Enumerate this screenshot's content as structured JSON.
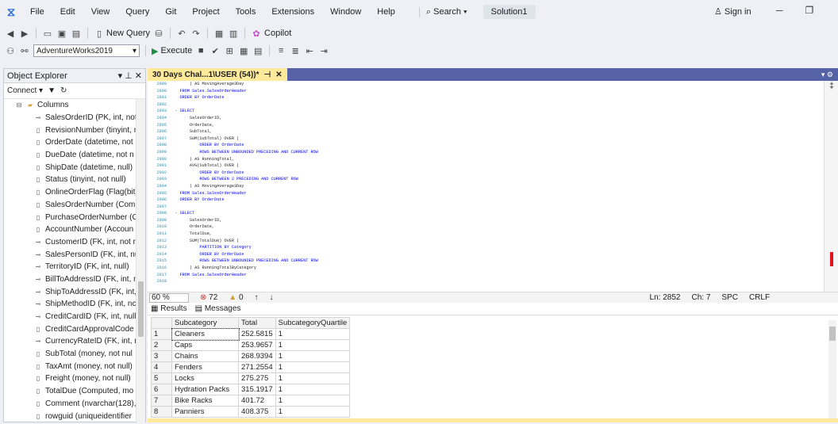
{
  "menu": {
    "items": [
      "File",
      "Edit",
      "View",
      "Query",
      "Git",
      "Project",
      "Tools",
      "Extensions",
      "Window",
      "Help"
    ],
    "search": "Search",
    "solution": "Solution1",
    "signin": "Sign in"
  },
  "toolbar": {
    "new_query": "New Query",
    "copilot": "Copilot",
    "database": "AdventureWorks2019",
    "execute": "Execute"
  },
  "object_explorer": {
    "title": "Object Explorer",
    "connect": "Connect",
    "columns_folder": "Columns",
    "columns": [
      "SalesOrderID (PK, int, not",
      "RevisionNumber (tinyint, n",
      "OrderDate (datetime, not",
      "DueDate (datetime, not n",
      "ShipDate (datetime, null)",
      "Status (tinyint, not null)",
      "OnlineOrderFlag (Flag(bit)",
      "SalesOrderNumber (Comp",
      "PurchaseOrderNumber (C",
      "AccountNumber (Accoun",
      "CustomerID (FK, int, not r",
      "SalesPersonID (FK, int, nul",
      "TerritoryID (FK, int, null)",
      "BillToAddressID (FK, int, n",
      "ShipToAddressID (FK, int,",
      "ShipMethodID (FK, int, nc",
      "CreditCardID (FK, int, null)",
      "CreditCardApprovalCode",
      "CurrencyRateID (FK, int, n",
      "SubTotal (money, not nul",
      "TaxAmt (money, not null)",
      "Freight (money, not null)",
      "TotalDue (Computed, mo",
      "Comment (nvarchar(128),",
      "rowguid (uniqueidentifier"
    ]
  },
  "tab": {
    "title": "30 Days Chal...1\\USER (54))*"
  },
  "editor": {
    "lines": [
      {
        "n": "2889",
        "t": "        ) AS MovingAverage3Day"
      },
      {
        "n": "2890",
        "t": "    FROM Sales.SalesOrderHeader"
      },
      {
        "n": "2891",
        "t": "    ORDER BY OrderDate"
      },
      {
        "n": "2892",
        "t": ""
      },
      {
        "n": "2893",
        "t": "  - SELECT"
      },
      {
        "n": "2894",
        "t": "        SalesOrderID,"
      },
      {
        "n": "2895",
        "t": "        OrderDate,"
      },
      {
        "n": "2896",
        "t": "        SubTotal,"
      },
      {
        "n": "2897",
        "t": "        SUM(SubTotal) OVER ("
      },
      {
        "n": "2898",
        "t": "            ORDER BY OrderDate"
      },
      {
        "n": "2899",
        "t": "            ROWS BETWEEN UNBOUNDED PRECEDING AND CURRENT ROW"
      },
      {
        "n": "2900",
        "t": "        ) AS RunningTotal,"
      },
      {
        "n": "2901",
        "t": "        AVG(SubTotal) OVER ("
      },
      {
        "n": "2902",
        "t": "            ORDER BY OrderDate"
      },
      {
        "n": "2903",
        "t": "            ROWS BETWEEN 2 PRECEDING AND CURRENT ROW"
      },
      {
        "n": "2904",
        "t": "        ) AS MovingAverage3Day"
      },
      {
        "n": "2905",
        "t": "    FROM Sales.SalesOrderHeader"
      },
      {
        "n": "2906",
        "t": "    ORDER BY OrderDate"
      },
      {
        "n": "2907",
        "t": ""
      },
      {
        "n": "2908",
        "t": "  - SELECT"
      },
      {
        "n": "2909",
        "t": "        SalesOrderID,"
      },
      {
        "n": "2910",
        "t": "        OrderDate,"
      },
      {
        "n": "2911",
        "t": "        TotalDue,"
      },
      {
        "n": "2912",
        "t": "        SUM(TotalDue) OVER ("
      },
      {
        "n": "2913",
        "t": "            PARTITION BY Category"
      },
      {
        "n": "2914",
        "t": "            ORDER BY OrderDate"
      },
      {
        "n": "2915",
        "t": "            ROWS BETWEEN UNBOUNDED PRECEDING AND CURRENT ROW"
      },
      {
        "n": "2916",
        "t": "        ) AS RunningTotalByCategory"
      },
      {
        "n": "2917",
        "t": "    FROM Sales.SalesOrderHeader"
      },
      {
        "n": "2918",
        "t": ""
      }
    ]
  },
  "status": {
    "zoom": "60 %",
    "errors": "72",
    "warnings": "0",
    "ln": "Ln: 2852",
    "ch": "Ch: 7",
    "spc": "SPC",
    "crlf": "CRLF"
  },
  "results": {
    "tab_results": "Results",
    "tab_messages": "Messages",
    "headers": [
      "Subcategory",
      "Total",
      "SubcategoryQuartile"
    ],
    "rows": [
      [
        "1",
        "Cleaners",
        "252.5815",
        "1"
      ],
      [
        "2",
        "Caps",
        "253.9657",
        "1"
      ],
      [
        "3",
        "Chains",
        "268.9394",
        "1"
      ],
      [
        "4",
        "Fenders",
        "271.2554",
        "1"
      ],
      [
        "5",
        "Locks",
        "275.275",
        "1"
      ],
      [
        "6",
        "Hydration Packs",
        "315.1917",
        "1"
      ],
      [
        "7",
        "Bike Racks",
        "401.72",
        "1"
      ],
      [
        "8",
        "Panniers",
        "408.375",
        "1"
      ]
    ]
  }
}
